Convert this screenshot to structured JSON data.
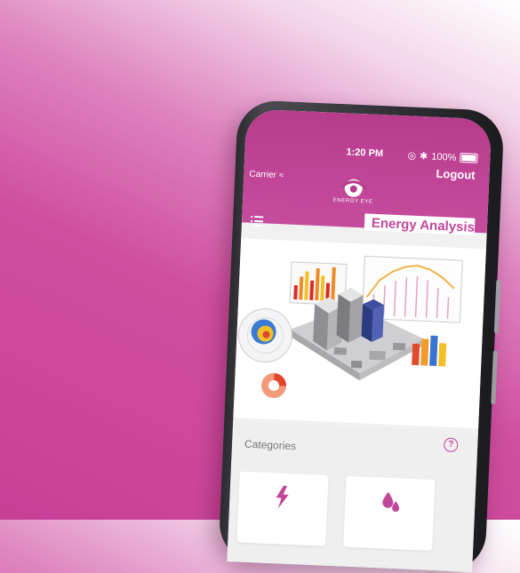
{
  "status_bar": {
    "time": "1:20 PM",
    "carrier": "Carrier",
    "battery": "100%"
  },
  "header": {
    "logo_text": "ENERGY EYE",
    "logout_label": "Logout",
    "page_title": "Energy Analysis"
  },
  "categories": {
    "title": "Categories",
    "help_symbol": "?",
    "items": [
      {
        "icon": "lightning-icon"
      },
      {
        "icon": "water-drops-icon"
      }
    ]
  },
  "colors": {
    "accent": "#c2479a",
    "background_magenta": "#c83f96",
    "card_background": "#ffffff"
  }
}
